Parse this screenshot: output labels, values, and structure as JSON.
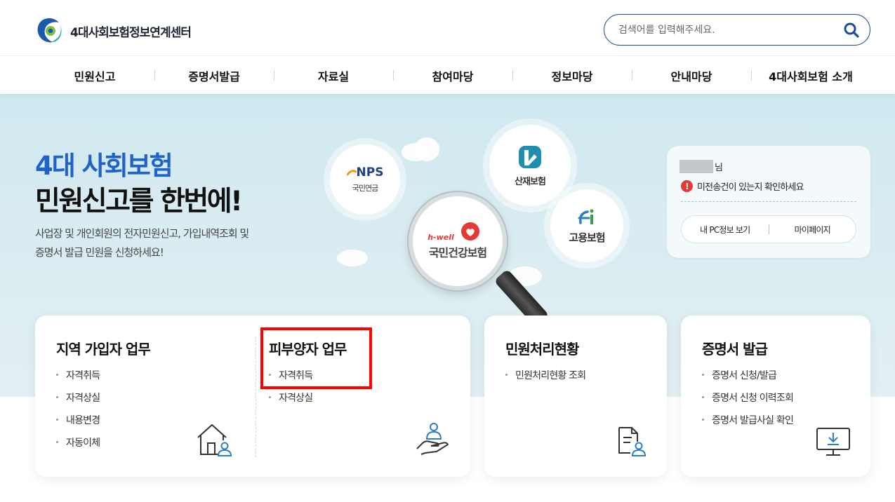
{
  "header": {
    "logo_text": "4대사회보험정보연계센터",
    "search_placeholder": "검색어를 입력해주세요."
  },
  "nav": {
    "items": [
      "민원신고",
      "증명서발급",
      "자료실",
      "참여마당",
      "정보마당",
      "안내마당",
      "4대사회보험 소개"
    ]
  },
  "hero": {
    "title_line1": "4대 사회보험",
    "title_line2": "민원신고를 한번에!",
    "desc_line1": "사업장 및 개인회원의 전자민원신고, 가입내역조회 및",
    "desc_line2": "증명서 발급 민원을 신청하세요!",
    "agencies": {
      "nps_logo": "NPS",
      "nps_label": "국민연금",
      "nhis_tag": "h-well",
      "nhis_label": "국민건강보험",
      "kcomwel_label": "산재보험",
      "ei_label": "고용보험"
    }
  },
  "user_card": {
    "name_suffix": "님",
    "notice": "미전송건이 있는지 확인하세요",
    "btn_pc_info": "내 PC정보 보기",
    "btn_mypage": "마이페이지"
  },
  "cards": {
    "regional": {
      "title": "지역 가입자 업무",
      "items": [
        "자격취득",
        "자격상실",
        "내용변경",
        "자동이체"
      ]
    },
    "dependent": {
      "title": "피부양자 업무",
      "items": [
        "자격취득",
        "자격상실"
      ]
    },
    "status": {
      "title": "민원처리현황",
      "items": [
        "민원처리현황 조회"
      ]
    },
    "certificate": {
      "title": "증명서 발급",
      "items": [
        "증명서 신청/발급",
        "증명서 신청 이력조회",
        "증명서 발급사실 확인"
      ]
    }
  },
  "colors": {
    "primary_blue": "#1f62c9",
    "navy": "#1b4f8f",
    "highlight_red": "#ff0000",
    "hero_bg": "#d6ebf1"
  }
}
